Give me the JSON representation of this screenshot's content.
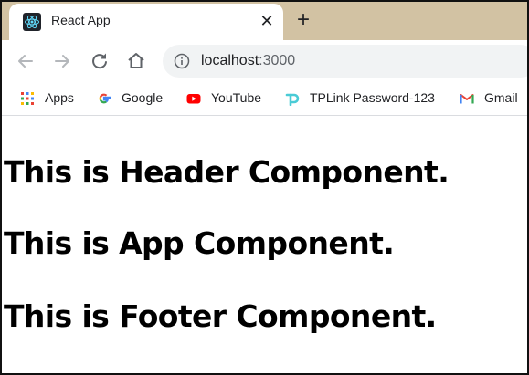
{
  "browser": {
    "tab": {
      "title": "React App",
      "close_glyph": "✕",
      "favicon": "react-logo-icon"
    },
    "new_tab_glyph": "+",
    "toolbar": {
      "back_icon": "arrow-left-icon",
      "forward_icon": "arrow-right-icon",
      "reload_icon": "reload-icon",
      "home_icon": "home-icon",
      "url_host": "localhost",
      "url_port": ":3000",
      "info_icon": "info-icon"
    },
    "bookmarks": [
      {
        "label": "Apps",
        "icon": "apps-grid-icon"
      },
      {
        "label": "Google",
        "icon": "google-icon"
      },
      {
        "label": "YouTube",
        "icon": "youtube-icon"
      },
      {
        "label": "TPLink Password-123",
        "icon": "tplink-icon"
      },
      {
        "label": "Gmail",
        "icon": "gmail-icon"
      }
    ]
  },
  "page": {
    "header_text": "This is Header Component.",
    "app_text": "This is App Component.",
    "footer_text": "This is Footer Component."
  },
  "colors": {
    "tab_strip": "#d2c2a3",
    "omnibox": "#f1f3f4",
    "react_blue": "#61dafb",
    "youtube_red": "#ff0000",
    "tplink_teal": "#4acbd6"
  }
}
